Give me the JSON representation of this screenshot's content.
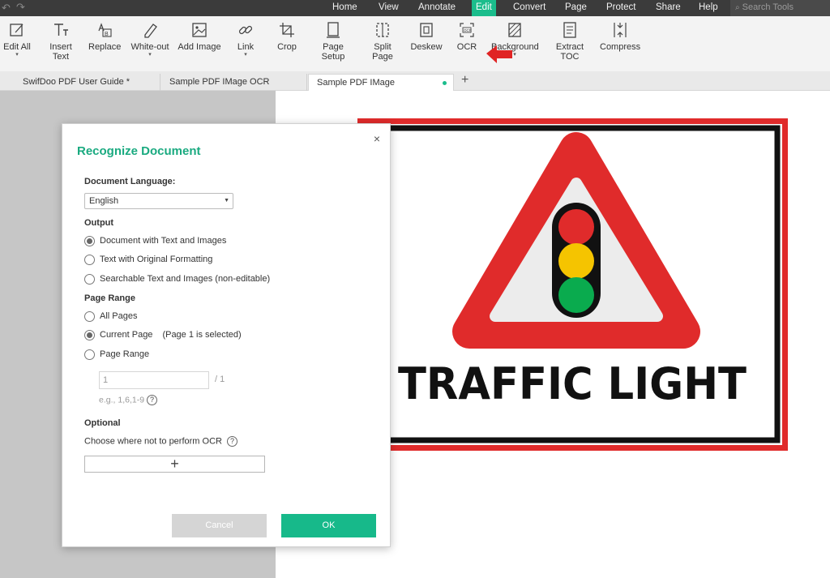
{
  "menubar": {
    "items": [
      "Home",
      "View",
      "Annotate",
      "Edit",
      "Convert",
      "Page",
      "Protect",
      "Share",
      "Help"
    ],
    "active": "Edit",
    "search_placeholder": "Search Tools"
  },
  "toolbar": {
    "tools": [
      {
        "label": "Edit All",
        "icon": "edit-all-icon"
      },
      {
        "label": "Insert Text",
        "icon": "insert-text-icon"
      },
      {
        "label": "Replace",
        "icon": "replace-icon"
      },
      {
        "label": "White-out",
        "icon": "white-out-icon"
      },
      {
        "label": "Add Image",
        "icon": "add-image-icon"
      },
      {
        "label": "Link",
        "icon": "link-icon"
      },
      {
        "label": "Crop",
        "icon": "crop-icon"
      },
      {
        "label": "Page Setup",
        "icon": "page-setup-icon"
      },
      {
        "label": "Split Page",
        "icon": "split-page-icon"
      },
      {
        "label": "Deskew",
        "icon": "deskew-icon"
      },
      {
        "label": "OCR",
        "icon": "ocr-icon"
      },
      {
        "label": "Background",
        "icon": "background-icon"
      },
      {
        "label": "Extract TOC",
        "icon": "extract-toc-icon"
      },
      {
        "label": "Compress",
        "icon": "compress-icon"
      }
    ]
  },
  "tabs": [
    {
      "label": "SwifDoo PDF User Guide *"
    },
    {
      "label": "Sample PDF IMage OCR"
    },
    {
      "label": "Sample PDF IMage",
      "active": true
    }
  ],
  "document": {
    "sign_text": "TRAFFIC LIGHT",
    "colors": {
      "red": "#e02b2b",
      "yellow": "#f5c400",
      "green": "#0aab4e"
    }
  },
  "dialog": {
    "title": "Recognize Document",
    "language_label": "Document Language:",
    "language_value": "English",
    "output_label": "Output",
    "output_options": [
      {
        "label": "Document with Text and Images",
        "selected": true
      },
      {
        "label": "Text with Original Formatting",
        "selected": false
      },
      {
        "label": "Searchable Text and Images (non-editable)",
        "selected": false
      }
    ],
    "range_label": "Page Range",
    "range_options": [
      {
        "label": "All Pages",
        "selected": false
      },
      {
        "label": "Current Page",
        "extra": "(Page 1 is selected)",
        "selected": true
      },
      {
        "label": "Page Range",
        "selected": false
      }
    ],
    "range_input_value": "1",
    "range_total": "/ 1",
    "range_hint": "e.g., 1,6,1-9",
    "optional_label": "Optional",
    "optional_desc": "Choose where not to perform OCR",
    "add_symbol": "+",
    "cancel_label": "Cancel",
    "ok_label": "OK",
    "close_symbol": "×"
  }
}
